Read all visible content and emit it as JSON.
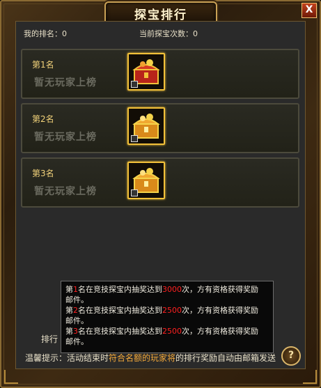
{
  "window": {
    "title": "探宝排行",
    "close_label": "X"
  },
  "stats": {
    "my_rank_label": "我的排名：",
    "my_rank_value": "0",
    "count_label": "当前探宝次数：",
    "count_value": "0"
  },
  "ranks": [
    {
      "label": "第1名",
      "empty_text": "暂无玩家上榜",
      "icon": "red-treasure-chest-icon"
    },
    {
      "label": "第2名",
      "empty_text": "暂无玩家上榜",
      "icon": "gold-treasure-chest-icon"
    },
    {
      "label": "第3名",
      "empty_text": "暂无玩家上榜",
      "icon": "gold-treasure-chest-icon"
    }
  ],
  "tooltip": {
    "line1_a": "第",
    "line1_num": "1",
    "line1_b": "名在竞技探宝内抽奖达到",
    "line1_val": "3000",
    "line1_c": "次，方有资格获得奖励",
    "line1_d": "邮件。",
    "line2_a": "第",
    "line2_num": "2",
    "line2_b": "名在竞技探宝内抽奖达到",
    "line2_val": "2500",
    "line2_c": "次，方有资格获得奖励",
    "line2_d": "邮件。",
    "line3_a": "第",
    "line3_num": "3",
    "line3_b": "名在竞技探宝内抽奖达到",
    "line3_val": "2500",
    "line3_c": "次，方有资格获得奖励",
    "line3_d": "邮件。"
  },
  "footer": {
    "label": "排行",
    "hint_prefix": "温馨提示：",
    "hint_a": "活动结束时",
    "hint_b": "符合名额的玩家将",
    "hint_c": "的排行奖励自动由邮箱发送"
  },
  "help_label": "?"
}
